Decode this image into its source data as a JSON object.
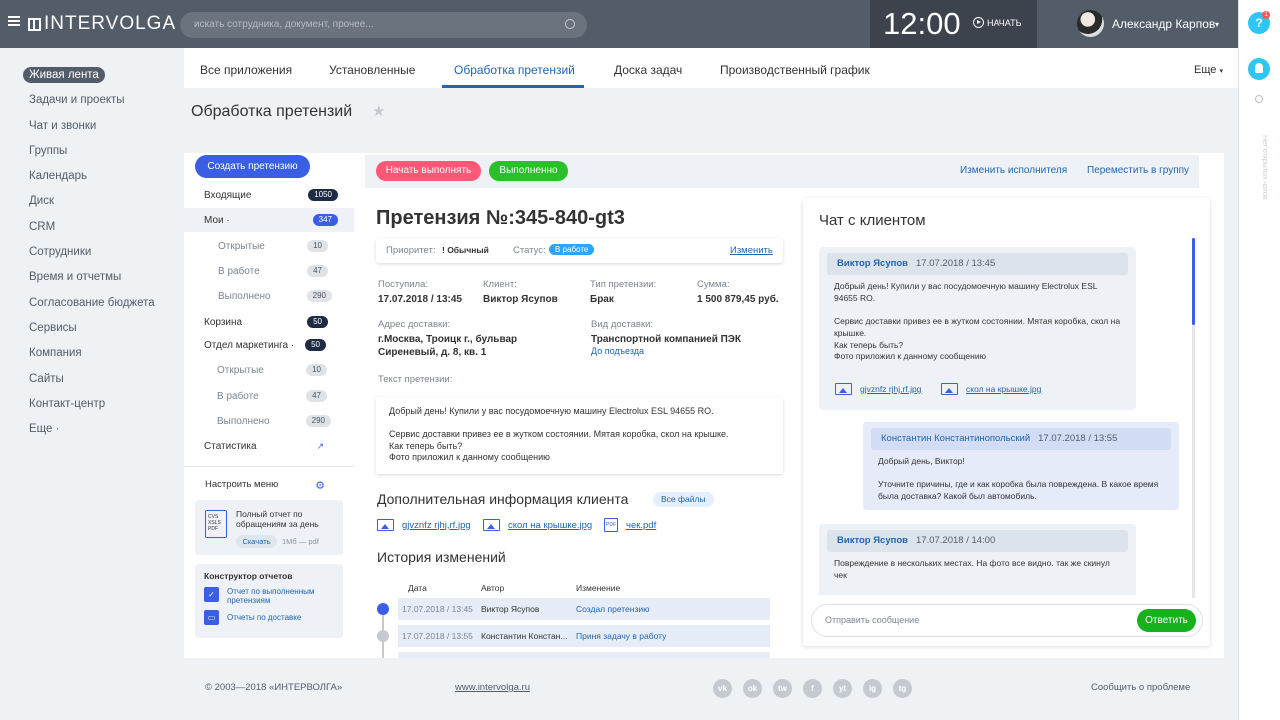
{
  "header": {
    "logo": "INTERVOLGA",
    "search_placeholder": "искать сотрудника, документ, прочее...",
    "clock": "12:00",
    "start_label": "НАЧАТЬ",
    "user_name": "Александр Карпов",
    "help_label": "?",
    "help_badge": "1"
  },
  "rail": {
    "vertical_text": "Нет открытых чатов"
  },
  "sidebar": {
    "items": [
      {
        "label": "Живая лента"
      },
      {
        "label": "Задачи и проекты"
      },
      {
        "label": "Чат и звонки"
      },
      {
        "label": "Группы"
      },
      {
        "label": "Календарь"
      },
      {
        "label": "Диск"
      },
      {
        "label": "CRM"
      },
      {
        "label": "Сотрудники"
      },
      {
        "label": "Время и отчетмы"
      },
      {
        "label": "Согласование бюджета"
      },
      {
        "label": "Сервисы"
      },
      {
        "label": "Компания"
      },
      {
        "label": "Сайты"
      },
      {
        "label": "Контакт-центр"
      },
      {
        "label": "Еще ·"
      }
    ]
  },
  "tabs": {
    "items": [
      "Все приложения",
      "Установленные",
      "Обработка претензий",
      "Доска задач",
      "Производственный график"
    ],
    "more": "Еще"
  },
  "page": {
    "title": "Обработка претензий"
  },
  "leftpanel": {
    "create_button": "Создать претензию",
    "folders": [
      {
        "label": "Входящие",
        "count": "1050"
      },
      {
        "label": "Мои ·",
        "count": "347"
      },
      {
        "label": "Открытые",
        "count": "10"
      },
      {
        "label": "В работе",
        "count": "47"
      },
      {
        "label": "Выполнено",
        "count": "290"
      },
      {
        "label": "Корзина",
        "count": "50"
      },
      {
        "label": "Отдел маркетинга ·",
        "count": "50"
      },
      {
        "label": "Открытые",
        "count": "10"
      },
      {
        "label": "В работе",
        "count": "47"
      },
      {
        "label": "Выполнено",
        "count": "290"
      },
      {
        "label": "Статистика",
        "count": ""
      }
    ],
    "settings": "Настроить меню",
    "report": {
      "icon_text": "CVS XSLS PDF",
      "title": "Полный отчет по обращениям за день",
      "download": "Скачать",
      "size": "1Мб — pdf"
    },
    "constructor": {
      "title": "Конструктор отчетов",
      "links": [
        "Отчет по выполненным претензиям",
        "Отчеты по доставке"
      ]
    }
  },
  "actions": {
    "start": "Начать выполнять",
    "done": "Выполненно",
    "change_executor": "Изменить исполнителя",
    "move_group": "Переместить в группу"
  },
  "claim": {
    "title": "Претензия №:345-840-gt3",
    "priority_label": "Приоритет:",
    "priority_value": "! Обычный",
    "status_label": "Статус:",
    "status_value": "В работе",
    "change": "Изменить",
    "fields": [
      {
        "label": "Поступила:",
        "value": "17.07.2018 / 13:45"
      },
      {
        "label": "Клиент:",
        "value": "Виктор Ясупов"
      },
      {
        "label": "Тип претензии:",
        "value": "Брак"
      },
      {
        "label": "Сумма:",
        "value": "1 500 879,45 руб."
      }
    ],
    "address_label": "Адрес доставки:",
    "address_value": "г.Москва, Троицк г., бульвар Сиреневый, д. 8, кв. 1",
    "delivery_label": "Вид доставки:",
    "delivery_value": "Транспортной компанией ПЭК",
    "delivery_link": "До подъезда",
    "text_label": "Текст претензии:",
    "text_lines": [
      "Добрый день! Купили у вас посудомоечную машину Electrolux ESL 94655 RO.",
      "",
      "Сервис доставки привез ее в жутком состоянии. Мятая коробка, скол на крышке.",
      "Как теперь быть?",
      "Фото приложил к данному сообщению"
    ],
    "extra_title": "Дополнительная информация клиента",
    "all_files": "Все файлы",
    "files": [
      "gjvznfz rjhj,rf.jpg",
      "скол на крышке.jpg",
      "чек.pdf"
    ],
    "pdf_icon_text": "PDF",
    "history_title": "История изменений",
    "history_headers": [
      "Дата",
      "Автор",
      "Изменение"
    ],
    "history": [
      {
        "date": "17.07.2018 / 13:45",
        "author": "Виктор Ясупов",
        "change": "Создал претензию"
      },
      {
        "date": "17.07.2018 / 13:55",
        "author": "Константин Констан...",
        "change": "Приня задачу в работу"
      }
    ]
  },
  "chat": {
    "title": "Чат с клиентом",
    "messages": [
      {
        "author": "Виктор Ясупов",
        "time": "17.07.2018 / 13:45",
        "lines": [
          "Добрый день! Купили у вас посудомоечную машину Electrolux ESL 94655 RO.",
          "",
          "Сервис доставки привез ее в жутком состоянии. Мятая коробка, скол на крышке.",
          "Как теперь быть?",
          "Фото приложил к данному сообщению"
        ],
        "files": [
          "gjvznfz rjhj,rf.jpg",
          "скол на крышке.jpg"
        ]
      },
      {
        "author": "Константин Константинопольский",
        "time": "17.07.2018 / 13:55",
        "lines": [
          "Добрый день, Виктор!",
          "",
          "Уточните причины, где и как коробка была повреждена. В какое время была доставка? Какой был автомобиль."
        ]
      },
      {
        "author": "Виктор Ясупов",
        "time": "17.07.2018 / 14:00",
        "lines": [
          "Повреждение в нескольких местах. На фото все видно. так же скинул чек"
        ]
      }
    ],
    "input_placeholder": "Отправить сообщение",
    "reply": "Ответить"
  },
  "footer": {
    "copyright": "© 2003—2018 «ИНТЕРВОЛГА»",
    "site": "www.intervolga.ru",
    "social": [
      "vk",
      "ok",
      "tw",
      "f",
      "yt",
      "ig",
      "tg"
    ],
    "report": "Сообщить о проблеме"
  }
}
